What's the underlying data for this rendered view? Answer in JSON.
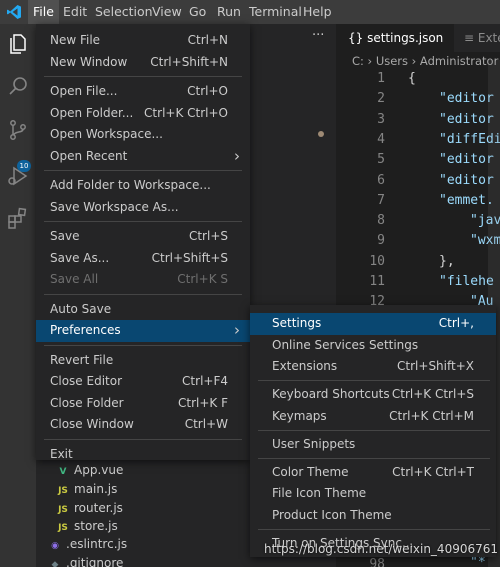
{
  "menubar": [
    {
      "label": "File",
      "open": true
    },
    {
      "label": "Edit"
    },
    {
      "label": "Selection"
    },
    {
      "label": "View"
    },
    {
      "label": "Go"
    },
    {
      "label": "Run"
    },
    {
      "label": "Terminal"
    },
    {
      "label": "Help"
    }
  ],
  "activity": {
    "badge": "10"
  },
  "sidebar": {
    "more": "···",
    "files": [
      {
        "name": "App.vue",
        "icon": "V",
        "icon_color": "#41b883"
      },
      {
        "name": "main.js",
        "icon": "JS",
        "icon_color": "#cbcb41"
      },
      {
        "name": "router.js",
        "icon": "JS",
        "icon_color": "#cbcb41"
      },
      {
        "name": "store.js",
        "icon": "JS",
        "icon_color": "#cbcb41"
      },
      {
        "name": ".eslintrc.js",
        "icon": "◉",
        "icon_color": "#8d6ee8"
      },
      {
        "name": ".gitignore",
        "icon": "◆",
        "icon_color": "#6d8086"
      }
    ]
  },
  "editor": {
    "tabs": [
      {
        "label": "{} settings.json",
        "active": true
      },
      {
        "label": "≡ Exten",
        "active": false
      }
    ],
    "breadcrumb": "C: › Users › Administrator › A",
    "lines": [
      {
        "no": "1",
        "text": "{",
        "cls": "c-punc"
      },
      {
        "no": "2",
        "text": "\"editor",
        "cls": "c-key"
      },
      {
        "no": "3",
        "text": "\"editor",
        "cls": "c-key"
      },
      {
        "no": "4",
        "text": "\"diffEdi",
        "cls": "c-key"
      },
      {
        "no": "5",
        "text": "\"editor",
        "cls": "c-key"
      },
      {
        "no": "6",
        "text": "\"editor",
        "cls": "c-key"
      },
      {
        "no": "7",
        "text": "\"emmet.",
        "cls": "c-key"
      },
      {
        "no": "8",
        "text": "\"jav",
        "cls": "c-key"
      },
      {
        "no": "9",
        "text": "\"wxm",
        "cls": "c-key"
      },
      {
        "no": "10",
        "text": "},",
        "cls": "c-punc"
      },
      {
        "no": "11",
        "text": "\"filehe",
        "cls": "c-key"
      },
      {
        "no": "12",
        "text": "\"Au",
        "cls": "c-key"
      }
    ],
    "bottom_line_no": "98",
    "bottom_code": "\"*"
  },
  "file_menu": {
    "items": [
      {
        "label": "New File",
        "shortcut": "Ctrl+N"
      },
      {
        "label": "New Window",
        "shortcut": "Ctrl+Shift+N"
      },
      {
        "sep": true
      },
      {
        "label": "Open File...",
        "shortcut": "Ctrl+O"
      },
      {
        "label": "Open Folder...",
        "shortcut": "Ctrl+K Ctrl+O"
      },
      {
        "label": "Open Workspace...",
        "shortcut": ""
      },
      {
        "label": "Open Recent",
        "shortcut": "",
        "submenu": true
      },
      {
        "sep": true
      },
      {
        "label": "Add Folder to Workspace...",
        "shortcut": ""
      },
      {
        "label": "Save Workspace As...",
        "shortcut": ""
      },
      {
        "sep": true
      },
      {
        "label": "Save",
        "shortcut": "Ctrl+S"
      },
      {
        "label": "Save As...",
        "shortcut": "Ctrl+Shift+S"
      },
      {
        "label": "Save All",
        "shortcut": "Ctrl+K S",
        "disabled": true
      },
      {
        "sep": true
      },
      {
        "label": "Auto Save",
        "shortcut": ""
      },
      {
        "label": "Preferences",
        "shortcut": "",
        "submenu": true,
        "highlight": true
      },
      {
        "sep": true
      },
      {
        "label": "Revert File",
        "shortcut": ""
      },
      {
        "label": "Close Editor",
        "shortcut": "Ctrl+F4"
      },
      {
        "label": "Close Folder",
        "shortcut": "Ctrl+K F"
      },
      {
        "label": "Close Window",
        "shortcut": "Ctrl+W"
      },
      {
        "sep": true
      },
      {
        "label": "Exit",
        "shortcut": ""
      }
    ]
  },
  "preferences_menu": {
    "items": [
      {
        "label": "Settings",
        "shortcut": "Ctrl+,",
        "highlight": true
      },
      {
        "label": "Online Services Settings",
        "shortcut": ""
      },
      {
        "label": "Extensions",
        "shortcut": "Ctrl+Shift+X"
      },
      {
        "sep": true
      },
      {
        "label": "Keyboard Shortcuts",
        "shortcut": "Ctrl+K Ctrl+S"
      },
      {
        "label": "Keymaps",
        "shortcut": "Ctrl+K Ctrl+M"
      },
      {
        "sep": true
      },
      {
        "label": "User Snippets",
        "shortcut": ""
      },
      {
        "sep": true
      },
      {
        "label": "Color Theme",
        "shortcut": "Ctrl+K Ctrl+T"
      },
      {
        "label": "File Icon Theme",
        "shortcut": ""
      },
      {
        "label": "Product Icon Theme",
        "shortcut": ""
      },
      {
        "sep": true
      },
      {
        "label": "Turn on Settings Sync...",
        "shortcut": ""
      }
    ]
  },
  "watermark": "https://blog.csdn.net/weixin_40906761",
  "colors": {
    "accent": "#094771",
    "logo": "#23a9f2",
    "activity_bar": "#333333",
    "menu_bg": "#252526"
  }
}
